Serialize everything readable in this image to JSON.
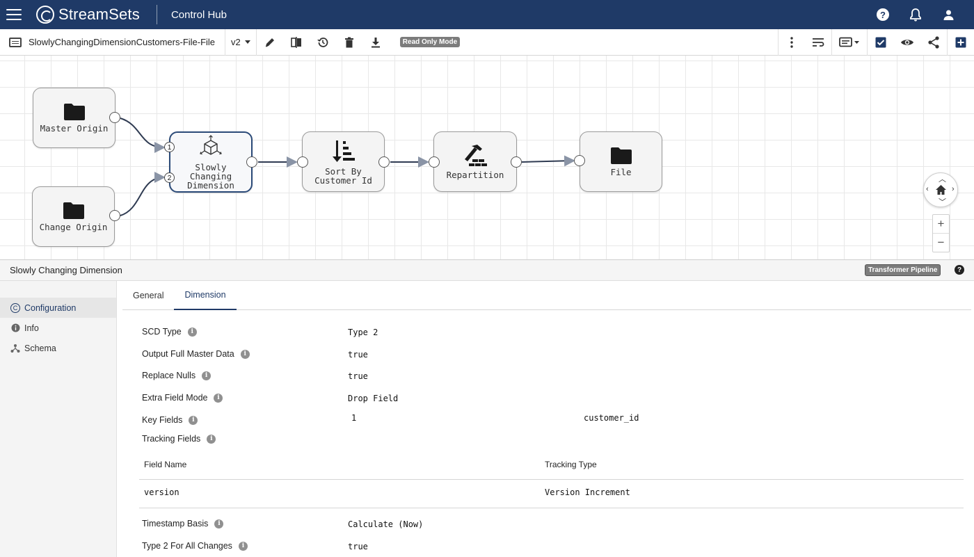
{
  "app": {
    "logo": "StreamSets",
    "section": "Control Hub"
  },
  "toolbar": {
    "pipeline_name": "SlowlyChangingDimensionCustomers-File-File",
    "version": "v2",
    "mode_badge": "Read Only Mode",
    "icons": [
      "edit-icon",
      "compare-icon",
      "history-icon",
      "delete-icon",
      "download-icon",
      "more-icon",
      "wrap-icon",
      "preview-icon",
      "validate-icon",
      "view-icon",
      "share-icon",
      "add-stage-icon"
    ]
  },
  "canvas": {
    "nodes": [
      {
        "id": "master",
        "label": "Master Origin",
        "icon": "folder-icon"
      },
      {
        "id": "change",
        "label": "Change Origin",
        "icon": "folder-icon"
      },
      {
        "id": "scd",
        "label": "Slowly Changing Dimension",
        "icon": "cube-icon",
        "inputs": [
          "1",
          "2"
        ]
      },
      {
        "id": "sort",
        "label": "Sort By Customer Id",
        "icon": "sort-icon"
      },
      {
        "id": "repartition",
        "label": "Repartition",
        "icon": "hammer-icon"
      },
      {
        "id": "file",
        "label": "File",
        "icon": "folder-icon"
      }
    ]
  },
  "panel": {
    "title": "Slowly Changing Dimension",
    "type_badge": "Transformer Pipeline",
    "nav": [
      {
        "label": "Configuration",
        "icon": "config-icon",
        "active": true
      },
      {
        "label": "Info",
        "icon": "info-icon",
        "active": false
      },
      {
        "label": "Schema",
        "icon": "schema-icon",
        "active": false
      }
    ],
    "tabs": [
      "General",
      "Dimension"
    ],
    "active_tab": "Dimension",
    "fields": {
      "scd_type": {
        "label": "SCD Type",
        "value": "Type 2"
      },
      "output_full": {
        "label": "Output Full Master Data",
        "value": "true"
      },
      "replace_nulls": {
        "label": "Replace Nulls",
        "value": "true"
      },
      "extra_field_mode": {
        "label": "Extra Field Mode",
        "value": "Drop Field"
      },
      "key_fields": {
        "label": "Key Fields",
        "index": "1",
        "value": "customer_id"
      },
      "tracking_fields": {
        "label": "Tracking Fields",
        "col_field_name": "Field Name",
        "col_tracking_type": "Tracking Type",
        "rows": [
          {
            "field_name": "version",
            "tracking_type": "Version Increment"
          }
        ]
      },
      "timestamp_basis": {
        "label": "Timestamp Basis",
        "value": "Calculate (Now)"
      },
      "type2_all_changes": {
        "label": "Type 2 For All Changes",
        "value": "true"
      }
    }
  },
  "colors": {
    "header": "#1f3a67",
    "selected_border": "#2b4a78",
    "badge": "#7c7c7c"
  }
}
